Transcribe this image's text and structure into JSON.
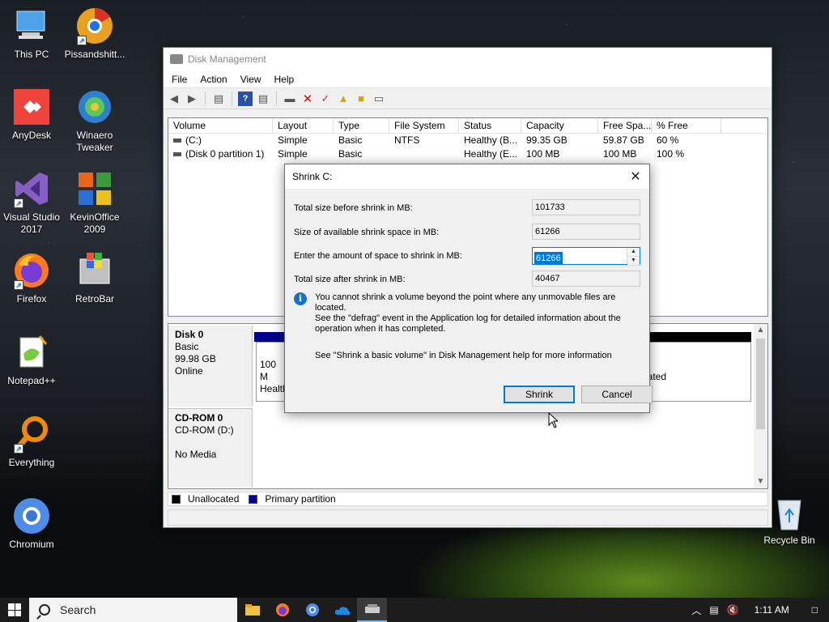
{
  "desktop": {
    "icons": [
      {
        "label": "This PC"
      },
      {
        "label": "Pissandshitt..."
      },
      {
        "label": "AnyDesk"
      },
      {
        "label": "Winaero Tweaker"
      },
      {
        "label": "Visual Studio 2017"
      },
      {
        "label": "KevinOffice 2009"
      },
      {
        "label": "Firefox"
      },
      {
        "label": "RetroBar"
      },
      {
        "label": "Notepad++"
      },
      {
        "label": "Everything"
      },
      {
        "label": "Chromium"
      }
    ],
    "recycle_bin": "Recycle Bin"
  },
  "window": {
    "title": "Disk Management",
    "menu": [
      "File",
      "Action",
      "View",
      "Help"
    ],
    "columns": [
      "Volume",
      "Layout",
      "Type",
      "File System",
      "Status",
      "Capacity",
      "Free Spa...",
      "% Free"
    ],
    "rows": [
      [
        "(C:)",
        "Simple",
        "Basic",
        "NTFS",
        "Healthy (B...",
        "99.35 GB",
        "59.87 GB",
        "60 %"
      ],
      [
        "(Disk 0 partition 1)",
        "Simple",
        "Basic",
        "",
        "Healthy (E...",
        "100 MB",
        "100 MB",
        "100 %"
      ]
    ],
    "disks": {
      "disk0": {
        "name": "Disk 0",
        "type": "Basic",
        "size": "99.98 GB",
        "status": "Online",
        "partition_text": "100 M",
        "partition_status": "Health",
        "right_text": "ated"
      },
      "cdrom": {
        "name": "CD-ROM 0",
        "drive": "CD-ROM (D:)",
        "media": "No Media"
      }
    },
    "legend": [
      "Unallocated",
      "Primary partition"
    ]
  },
  "dialog": {
    "title": "Shrink C:",
    "fields": [
      {
        "label": "Total size before shrink in MB:",
        "value": "101733"
      },
      {
        "label": "Size of available shrink space in MB:",
        "value": "61266"
      },
      {
        "label": "Enter the amount of space to shrink in MB:",
        "value": "61266"
      },
      {
        "label": "Total size after shrink in MB:",
        "value": "40467"
      }
    ],
    "info_lines": [
      "You cannot shrink a volume beyond the point where any unmovable files are located.",
      "See the \"defrag\" event in the Application log for detailed information about the",
      "operation when it has completed."
    ],
    "help": "See \"Shrink a basic volume\" in Disk Management help for more information",
    "shrink_label": "Shrink",
    "cancel_label": "Cancel"
  },
  "taskbar": {
    "search_label": "Search",
    "time": "1:11 AM"
  },
  "colors": {
    "accent": "#0078d7",
    "partition_blue": "#00008b"
  }
}
